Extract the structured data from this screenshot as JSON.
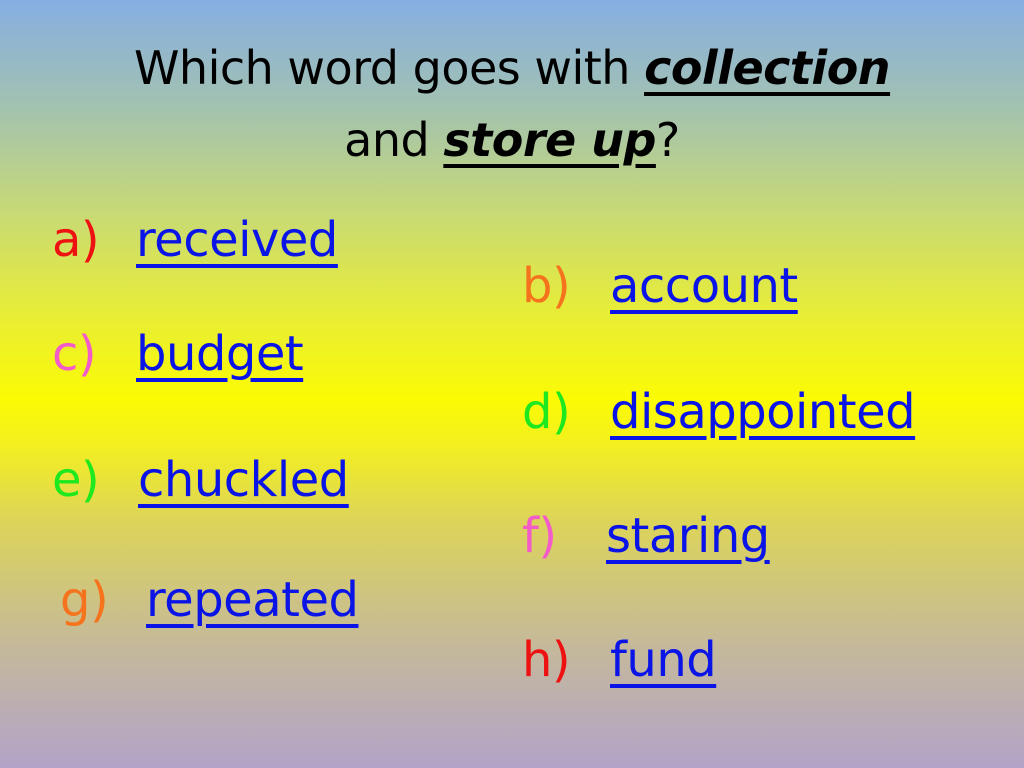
{
  "question": {
    "prefix": "Which word goes with",
    "keyword1": "collection",
    "connector": "and",
    "keyword2": "store up",
    "suffix": "?"
  },
  "options": [
    {
      "letter": "a)",
      "word": "received",
      "letter_color": "#ee1111"
    },
    {
      "letter": "b)",
      "word": "account",
      "letter_color": "#f6731e"
    },
    {
      "letter": "c)",
      "word": "budget",
      "letter_color": "#f35cc8"
    },
    {
      "letter": "d)",
      "word": "disappointed",
      "letter_color": "#1ee81e"
    },
    {
      "letter": "e)",
      "word": "chuckled",
      "letter_color": "#1ee81e"
    },
    {
      "letter": "f)",
      "word": "staring",
      "letter_color": "#f35cc8"
    },
    {
      "letter": "g)",
      "word": "repeated",
      "letter_color": "#f6731e"
    },
    {
      "letter": "h)",
      "word": "fund",
      "letter_color": "#ee1111"
    }
  ],
  "colors": {
    "word": "#0a14e6",
    "title": "#000000"
  }
}
